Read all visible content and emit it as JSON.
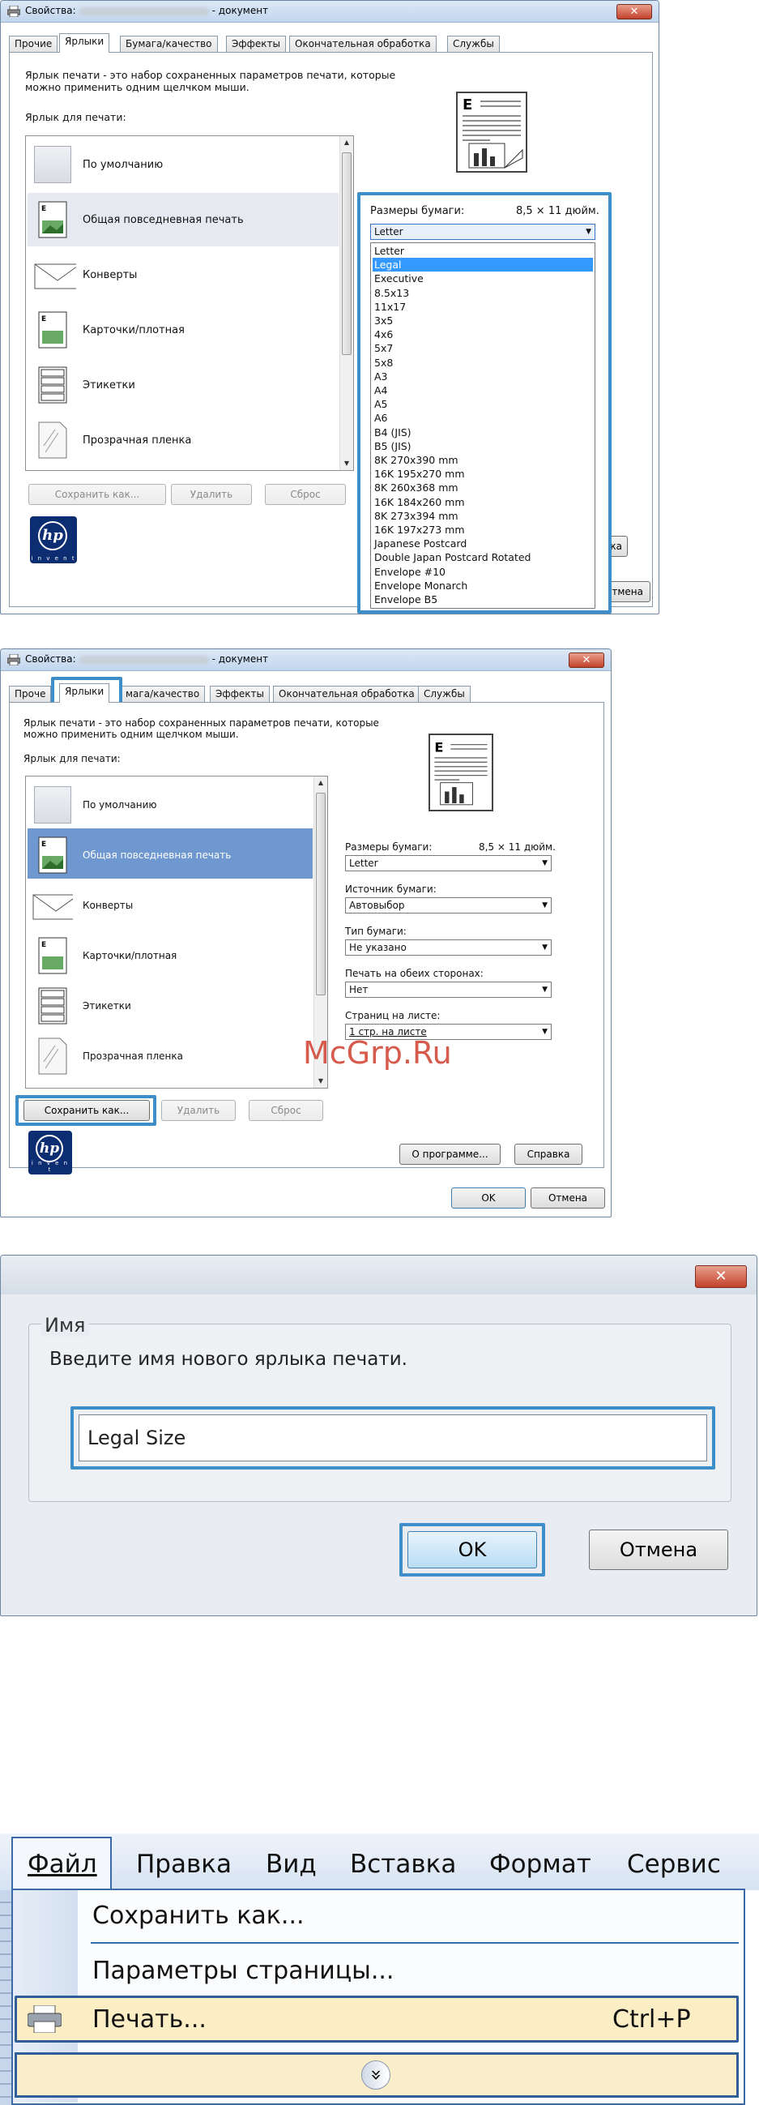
{
  "panel1": {
    "title_prefix": "Свойства:",
    "title_suffix": "- документ",
    "close": "✕",
    "tabs": [
      "Прочие",
      "Ярлыки",
      "Бумага/качество",
      "Эффекты",
      "Окончательная обработка",
      "Службы"
    ],
    "description": "Ярлык печати - это набор сохраненных параметров печати, которые можно применить одним щелчком мыши.",
    "list_label": "Ярлык для печати:",
    "shortcuts": [
      "По умолчанию",
      "Общая повседневная печать",
      "Конверты",
      "Карточки/плотная",
      "Этикетки",
      "Прозрачная пленка"
    ],
    "save_button": "Сохранить как...",
    "delete_button": "Удалить",
    "reset_button": "Сброс",
    "paper_size_label": "Размеры бумаги:",
    "paper_size_value": "8,5 × 11 дюйм.",
    "paper_dropdown": "Letter",
    "paper_options": [
      "Letter",
      "Legal",
      "Executive",
      "8.5x13",
      "11x17",
      "3x5",
      "4x6",
      "5x7",
      "5x8",
      "A3",
      "A4",
      "A5",
      "A6",
      "B4 (JIS)",
      "B5 (JIS)",
      "8K 270x390 mm",
      "16K 195x270 mm",
      "8K 260x368 mm",
      "16K 184x260 mm",
      "8K 273x394 mm",
      "16K 197x273 mm",
      "Japanese Postcard",
      "Double Japan Postcard Rotated",
      "Envelope #10",
      "Envelope Monarch",
      "Envelope B5"
    ],
    "partial_button_1": "ка",
    "partial_button_2": "тмена"
  },
  "panel2": {
    "title_prefix": "Свойства:",
    "title_suffix": "- документ",
    "close": "✕",
    "tabs": [
      "Проче",
      "Ярлыки",
      "мага/качество",
      "Эффекты",
      "Окончательная обработка",
      "Службы"
    ],
    "description": "Ярлык печати - это набор сохраненных параметров печати, которые можно применить одним щелчком мыши.",
    "list_label": "Ярлык для печати:",
    "shortcuts": [
      "По умолчанию",
      "Общая повседневная печать",
      "Конверты",
      "Карточки/плотная",
      "Этикетки",
      "Прозрачная пленка"
    ],
    "save_button": "Сохранить как...",
    "delete_button": "Удалить",
    "reset_button": "Сброс",
    "paper_size_label": "Размеры бумаги:",
    "paper_size_value": "8,5 × 11 дюйм.",
    "paper_dropdown": "Letter",
    "source_label": "Источник бумаги:",
    "source_value": "Автовыбор",
    "type_label": "Тип бумаги:",
    "type_value": "Не указано",
    "duplex_label": "Печать на обеих сторонах:",
    "duplex_value": "Нет",
    "pages_label": "Страниц на листе:",
    "pages_value": "1 стр. на листе",
    "about_button": "О программе...",
    "help_button": "Справка",
    "ok_button": "OK",
    "cancel_button": "Отмена"
  },
  "watermark": "McGrp.Ru",
  "panel3": {
    "close": "✕",
    "group_label": "Имя",
    "prompt": "Введите имя нового ярлыка печати.",
    "name_value": "Legal Size",
    "ok_button": "OK",
    "cancel_button": "Отмена"
  },
  "panel4": {
    "menu": [
      "Файл",
      "Правка",
      "Вид",
      "Вставка",
      "Формат",
      "Сервис"
    ],
    "items": {
      "save_as": "Сохранить как...",
      "page_setup": "Параметры страницы...",
      "print": "Печать...",
      "print_shortcut": "Ctrl+P",
      "expand": "»"
    }
  }
}
